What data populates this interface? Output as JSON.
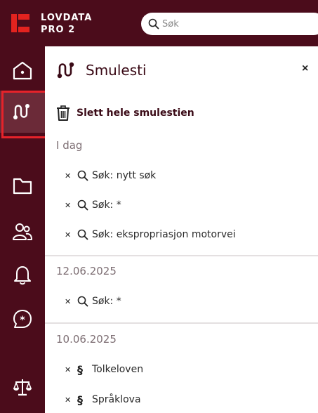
{
  "app": {
    "brand_line1": "LOVDATA",
    "brand_line2": "PRO 2"
  },
  "search": {
    "placeholder": "Søk"
  },
  "rail": {
    "items": [
      {
        "icon": "home-icon"
      },
      {
        "icon": "breadcrumb-trail-icon",
        "active": true
      },
      {
        "icon": "folder-icon"
      },
      {
        "icon": "users-icon"
      },
      {
        "icon": "bell-icon"
      },
      {
        "icon": "chat-asterisk-icon"
      },
      {
        "icon": "scales-icon"
      }
    ]
  },
  "panel": {
    "title": "Smulesti",
    "close_label": "×",
    "clear_all_label": "Slett hele smulestien",
    "groups": [
      {
        "label": "I dag",
        "entries": [
          {
            "icon": "search-icon",
            "text": "Søk: nytt søk"
          },
          {
            "icon": "search-icon",
            "text": "Søk: *"
          },
          {
            "icon": "search-icon",
            "text": "Søk: ekspropriasjon motorvei"
          }
        ]
      },
      {
        "label": "12.06.2025",
        "entries": [
          {
            "icon": "search-icon",
            "text": "Søk: *"
          }
        ]
      },
      {
        "label": "10.06.2025",
        "entries": [
          {
            "icon": "paragraph-icon",
            "symbol": "§",
            "text": "Tolkeloven"
          },
          {
            "icon": "paragraph-icon",
            "symbol": "§",
            "text": "Språklova"
          }
        ]
      }
    ]
  },
  "colors": {
    "brand_dark": "#4b0c1b",
    "logo_red": "#e3231f",
    "active_outline": "#e5232a"
  }
}
